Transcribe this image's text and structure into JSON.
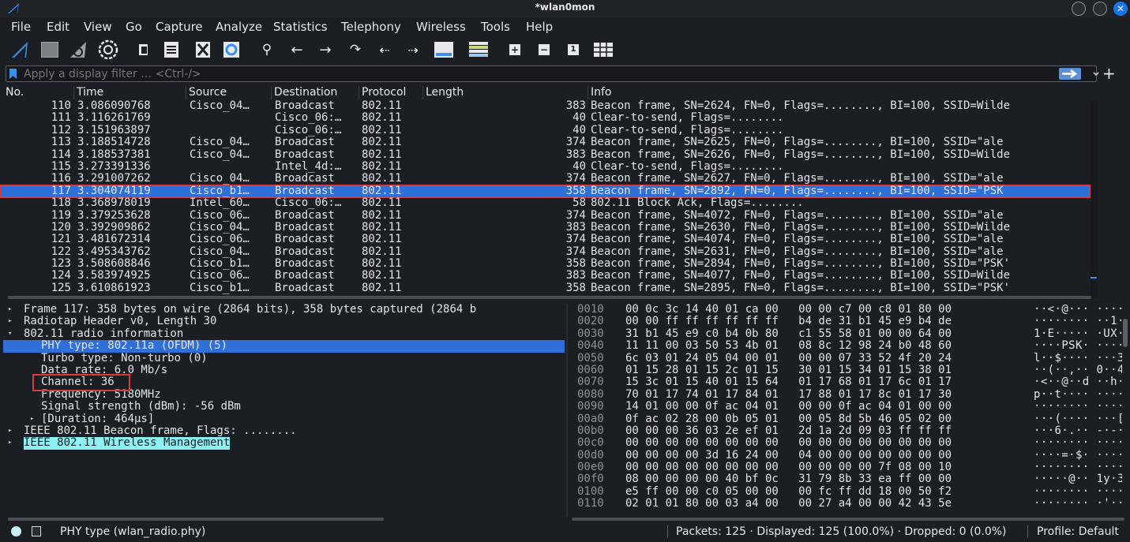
{
  "window": {
    "title": "*wlan0mon"
  },
  "menu": [
    "File",
    "Edit",
    "View",
    "Go",
    "Capture",
    "Analyze",
    "Statistics",
    "Telephony",
    "Wireless",
    "Tools",
    "Help"
  ],
  "toolbar": {
    "icons": [
      "shark-fin-start-icon",
      "stop-square-icon",
      "restart-shark-icon",
      "capture-options-gear-icon",
      "open-file-icon",
      "save-file-icon",
      "close-file-icon",
      "reload-file-icon",
      "find-packet-icon",
      "go-back-icon",
      "go-forward-icon",
      "go-to-packet-icon",
      "go-first-icon",
      "go-last-icon",
      "autoscroll-icon",
      "colorize-icon",
      "zoom-in-icon",
      "zoom-out-icon",
      "normal-size-icon",
      "resize-columns-icon"
    ]
  },
  "filter": {
    "placeholder": "Apply a display filter … <Ctrl-/>"
  },
  "columns": [
    "No.",
    "Time",
    "Source",
    "Destination",
    "Protocol",
    "Length",
    "Info"
  ],
  "packets": [
    {
      "no": "110",
      "time": "3.086090768",
      "src": "Cisco_04…",
      "dst": "Broadcast",
      "proto": "802.11",
      "len": "383",
      "info": "Beacon frame, SN=2624, FN=0, Flags=........, BI=100, SSID=Wilde"
    },
    {
      "no": "111",
      "time": "3.116261769",
      "src": "",
      "dst": "Cisco_06:…",
      "proto": "802.11",
      "len": "40",
      "info": "Clear-to-send, Flags=........"
    },
    {
      "no": "112",
      "time": "3.151963897",
      "src": "",
      "dst": "Cisco_06:…",
      "proto": "802.11",
      "len": "40",
      "info": "Clear-to-send, Flags=........"
    },
    {
      "no": "113",
      "time": "3.188514728",
      "src": "Cisco_04…",
      "dst": "Broadcast",
      "proto": "802.11",
      "len": "374",
      "info": "Beacon frame, SN=2625, FN=0, Flags=........, BI=100, SSID=\"ale"
    },
    {
      "no": "114",
      "time": "3.188537381",
      "src": "Cisco_04…",
      "dst": "Broadcast",
      "proto": "802.11",
      "len": "383",
      "info": "Beacon frame, SN=2626, FN=0, Flags=........, BI=100, SSID=Wilde"
    },
    {
      "no": "115",
      "time": "3.273391336",
      "src": "",
      "dst": "Intel_4d:…",
      "proto": "802.11",
      "len": "40",
      "info": "Clear-to-send, Flags=........"
    },
    {
      "no": "116",
      "time": "3.291007262",
      "src": "Cisco_04…",
      "dst": "Broadcast",
      "proto": "802.11",
      "len": "374",
      "info": "Beacon frame, SN=2627, FN=0, Flags=........, BI=100, SSID=\"ale"
    },
    {
      "no": "117",
      "time": "3.304074119",
      "src": "Cisco_b1…",
      "dst": "Broadcast",
      "proto": "802.11",
      "len": "358",
      "info": "Beacon frame, SN=2892, FN=0, Flags=........, BI=100, SSID=\"PSK"
    },
    {
      "no": "118",
      "time": "3.368978019",
      "src": "Intel_60…",
      "dst": "Cisco_06:…",
      "proto": "802.11",
      "len": "58",
      "info": "802.11 Block Ack, Flags=........"
    },
    {
      "no": "119",
      "time": "3.379253628",
      "src": "Cisco_06…",
      "dst": "Broadcast",
      "proto": "802.11",
      "len": "374",
      "info": "Beacon frame, SN=4072, FN=0, Flags=........, BI=100, SSID=\"ale"
    },
    {
      "no": "120",
      "time": "3.392909862",
      "src": "Cisco_04…",
      "dst": "Broadcast",
      "proto": "802.11",
      "len": "383",
      "info": "Beacon frame, SN=2630, FN=0, Flags=........, BI=100, SSID=Wilde"
    },
    {
      "no": "121",
      "time": "3.481672314",
      "src": "Cisco_06…",
      "dst": "Broadcast",
      "proto": "802.11",
      "len": "374",
      "info": "Beacon frame, SN=4074, FN=0, Flags=........, BI=100, SSID=\"ale"
    },
    {
      "no": "122",
      "time": "3.495343762",
      "src": "Cisco_04…",
      "dst": "Broadcast",
      "proto": "802.11",
      "len": "374",
      "info": "Beacon frame, SN=2631, FN=0, Flags=........, BI=100, SSID=\"ale"
    },
    {
      "no": "123",
      "time": "3.508608846",
      "src": "Cisco_b1…",
      "dst": "Broadcast",
      "proto": "802.11",
      "len": "358",
      "info": "Beacon frame, SN=2894, FN=0, Flags=........, BI=100, SSID=\"PSK'"
    },
    {
      "no": "124",
      "time": "3.583974925",
      "src": "Cisco_06…",
      "dst": "Broadcast",
      "proto": "802.11",
      "len": "383",
      "info": "Beacon frame, SN=4077, FN=0, Flags=........, BI=100, SSID=Wilde"
    },
    {
      "no": "125",
      "time": "3.610861923",
      "src": "Cisco_b1…",
      "dst": "Broadcast",
      "proto": "802.11",
      "len": "358",
      "info": "Beacon frame, SN=2895, FN=0, Flags=........, BI=100, SSID=\"PSK'"
    }
  ],
  "selected_packet": "117",
  "details": [
    {
      "level": 0,
      "arrow": "right",
      "text": "Frame 117: 358 bytes on wire (2864 bits), 358 bytes captured (2864 b"
    },
    {
      "level": 0,
      "arrow": "right",
      "text": "Radiotap Header v0, Length 30"
    },
    {
      "level": 0,
      "arrow": "down",
      "text": "802.11 radio information"
    },
    {
      "level": 1,
      "arrow": "",
      "text": "PHY type: 802.11a (OFDM) (5)",
      "hl": "blue"
    },
    {
      "level": 1,
      "arrow": "",
      "text": "Turbo type: Non-turbo (0)"
    },
    {
      "level": 1,
      "arrow": "",
      "text": "Data rate: 6.0 Mb/s"
    },
    {
      "level": 1,
      "arrow": "",
      "text": "Channel: 36"
    },
    {
      "level": 1,
      "arrow": "",
      "text": "Frequency: 5180MHz"
    },
    {
      "level": 1,
      "arrow": "",
      "text": "Signal strength (dBm): -56 dBm"
    },
    {
      "level": 1,
      "arrow": "right",
      "text": "[Duration: 464µs]"
    },
    {
      "level": 0,
      "arrow": "right",
      "text": "IEEE 802.11 Beacon frame, Flags: ........"
    },
    {
      "level": 0,
      "arrow": "right",
      "text": "IEEE 802.11 Wireless Management",
      "hl": "cyan"
    }
  ],
  "bytes": [
    {
      "off": "0010",
      "hex": "00 0c 3c 14 40 01 ca 00   00 00 c7 00 c8 01 80 00",
      "ascii": "··<·@··· ········"
    },
    {
      "off": "0020",
      "hex": "00 00 ff ff ff ff ff ff   b4 de 31 b1 45 e9 b4 de",
      "ascii": "········ ··1·E···"
    },
    {
      "off": "0030",
      "hex": "31 b1 45 e9 c0 b4 0b 80   c1 55 58 01 00 00 64 00",
      "ascii": "1·E····· ·UX···d·"
    },
    {
      "off": "0040",
      "hex": "11 11 00 03 50 53 4b 01   08 8c 12 98 24 b0 48 60",
      "ascii": "····PSK· ····$·H`"
    },
    {
      "off": "0050",
      "hex": "6c 03 01 24 05 04 00 01   00 00 07 33 52 4f 20 24",
      "ascii": "l··$···· ···3RO $"
    },
    {
      "off": "0060",
      "hex": "01 15 28 01 15 2c 01 15   30 01 15 34 01 15 38 01",
      "ascii": "··(··,·· 0··4··8·"
    },
    {
      "off": "0070",
      "hex": "15 3c 01 15 40 01 15 64   01 17 68 01 17 6c 01 17",
      "ascii": "·<··@··d ··h··l··"
    },
    {
      "off": "0080",
      "hex": "70 01 17 74 01 17 84 01   17 88 01 17 8c 01 17 30",
      "ascii": "p··t···· ·······0"
    },
    {
      "off": "0090",
      "hex": "14 01 00 00 0f ac 04 01   00 00 0f ac 04 01 00 00",
      "ascii": "········ ········"
    },
    {
      "off": "00a0",
      "hex": "0f ac 02 28 00 0b 05 01   00 05 8d 5b 46 05 02 00",
      "ascii": "···(···· ···[F···"
    },
    {
      "off": "00b0",
      "hex": "00 00 00 36 03 2e ef 01   2d 1a 2d 09 03 ff ff ff",
      "ascii": "···6·.·· -·-·····"
    },
    {
      "off": "00c0",
      "hex": "00 00 00 00 00 00 00 00   00 00 00 00 00 00 00 00",
      "ascii": "········ ········"
    },
    {
      "off": "00d0",
      "hex": "00 00 00 00 3d 16 24 00   04 00 00 00 00 00 00 00",
      "ascii": "····=·$· ········"
    },
    {
      "off": "00e0",
      "hex": "00 00 00 00 00 00 00 00   00 00 00 00 7f 08 00 10",
      "ascii": "········ ········"
    },
    {
      "off": "00f0",
      "hex": "08 00 00 00 00 40 bf 0c   31 79 8b 33 ea ff 00 00",
      "ascii": "·····@·· 1y·3····"
    },
    {
      "off": "0100",
      "hex": "e5 ff 00 00 c0 05 00 00   00 fc ff dd 18 00 50 f2",
      "ascii": "········ ······P·"
    },
    {
      "off": "0110",
      "hex": "02 01 01 80 00 03 a4 00   00 27 a4 00 00 42 43 5e",
      "ascii": "········ ·'···BC^"
    }
  ],
  "status": {
    "field": "PHY type (wlan_radio.phy)",
    "packets": "Packets: 125 · Displayed: 125 (100.0%) · Dropped: 0 (0.0%)",
    "profile": "Profile: Default"
  }
}
